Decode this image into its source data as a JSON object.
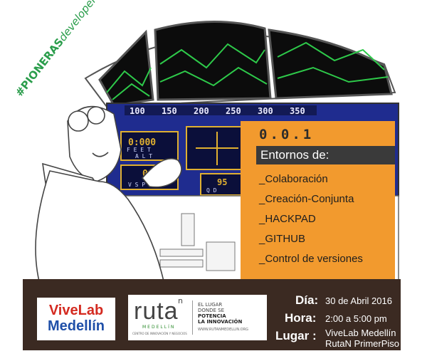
{
  "tag": {
    "bold": "#PIONERAS",
    "italic": "developers"
  },
  "instruments": {
    "scale": [
      "100",
      "150",
      "200",
      "250",
      "300",
      "350"
    ],
    "altitude_value": "0:000",
    "feet_label": "F E E T",
    "alt_label": "A L T",
    "speed_value": "000",
    "vsp_label": "V S P",
    "other_value": "95",
    "qd_label": "Q D"
  },
  "panel": {
    "version": "0.0.1",
    "heading": "Entornos de:",
    "items": [
      "_Colaboración",
      "_Creación-Conjunta",
      "_HACKPAD",
      "_GITHUB",
      "_Control de versiones"
    ]
  },
  "footer": {
    "vivelab": {
      "line1": "ViveLab",
      "line2": "Medellín"
    },
    "rutan": {
      "word": "ruta",
      "sup": "n",
      "city": "MEDELLÍN",
      "subtitle": "CENTRO DE INNOVACIÓN Y NEGOCIOS",
      "slogan1": "EL LUGAR",
      "slogan2": "DONDE SE",
      "slogan3": "POTENCIA",
      "slogan4": "LA INNOVACIÓN",
      "url": "WWW.RUTANMEDELLIN.ORG"
    },
    "dia_label": "Día:",
    "dia_value": "30 de Abril 2016",
    "hora_label": "Hora:",
    "hora_value": "2:00  a 5:00 pm",
    "lugar_label": "Lugar :",
    "lugar_value1": "ViveLab Medellín",
    "lugar_value2": "RutaN PrimerPiso"
  },
  "colors": {
    "orange": "#f29a2e",
    "dark_band": "#3a3a3a",
    "footer_bg": "#3b2a22",
    "screen_green": "#2eca4a",
    "instrument_blue": "#1f2c8f"
  }
}
